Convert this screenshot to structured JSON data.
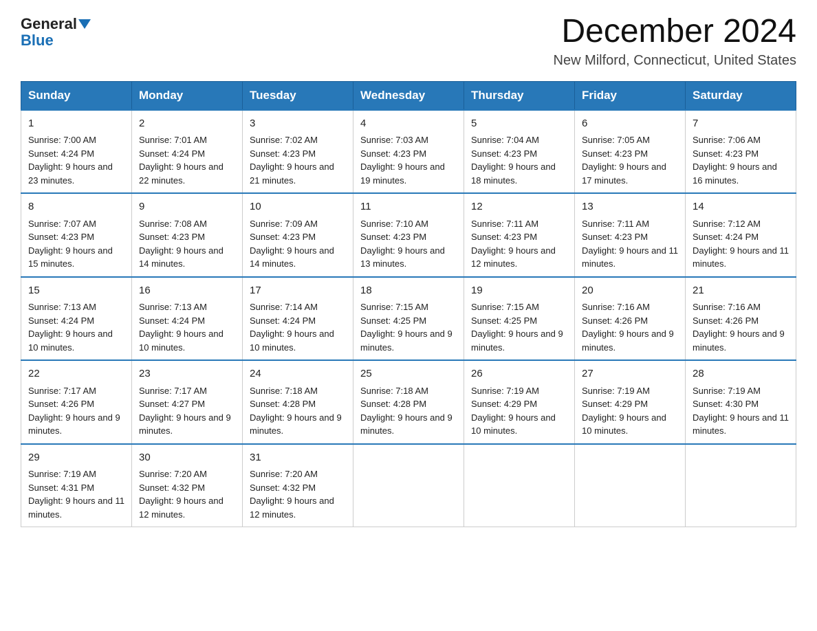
{
  "logo": {
    "word1": "General",
    "word2": "Blue"
  },
  "header": {
    "title": "December 2024",
    "subtitle": "New Milford, Connecticut, United States"
  },
  "weekdays": [
    "Sunday",
    "Monday",
    "Tuesday",
    "Wednesday",
    "Thursday",
    "Friday",
    "Saturday"
  ],
  "weeks": [
    [
      {
        "day": "1",
        "sunrise": "7:00 AM",
        "sunset": "4:24 PM",
        "daylight": "9 hours and 23 minutes."
      },
      {
        "day": "2",
        "sunrise": "7:01 AM",
        "sunset": "4:24 PM",
        "daylight": "9 hours and 22 minutes."
      },
      {
        "day": "3",
        "sunrise": "7:02 AM",
        "sunset": "4:23 PM",
        "daylight": "9 hours and 21 minutes."
      },
      {
        "day": "4",
        "sunrise": "7:03 AM",
        "sunset": "4:23 PM",
        "daylight": "9 hours and 19 minutes."
      },
      {
        "day": "5",
        "sunrise": "7:04 AM",
        "sunset": "4:23 PM",
        "daylight": "9 hours and 18 minutes."
      },
      {
        "day": "6",
        "sunrise": "7:05 AM",
        "sunset": "4:23 PM",
        "daylight": "9 hours and 17 minutes."
      },
      {
        "day": "7",
        "sunrise": "7:06 AM",
        "sunset": "4:23 PM",
        "daylight": "9 hours and 16 minutes."
      }
    ],
    [
      {
        "day": "8",
        "sunrise": "7:07 AM",
        "sunset": "4:23 PM",
        "daylight": "9 hours and 15 minutes."
      },
      {
        "day": "9",
        "sunrise": "7:08 AM",
        "sunset": "4:23 PM",
        "daylight": "9 hours and 14 minutes."
      },
      {
        "day": "10",
        "sunrise": "7:09 AM",
        "sunset": "4:23 PM",
        "daylight": "9 hours and 14 minutes."
      },
      {
        "day": "11",
        "sunrise": "7:10 AM",
        "sunset": "4:23 PM",
        "daylight": "9 hours and 13 minutes."
      },
      {
        "day": "12",
        "sunrise": "7:11 AM",
        "sunset": "4:23 PM",
        "daylight": "9 hours and 12 minutes."
      },
      {
        "day": "13",
        "sunrise": "7:11 AM",
        "sunset": "4:23 PM",
        "daylight": "9 hours and 11 minutes."
      },
      {
        "day": "14",
        "sunrise": "7:12 AM",
        "sunset": "4:24 PM",
        "daylight": "9 hours and 11 minutes."
      }
    ],
    [
      {
        "day": "15",
        "sunrise": "7:13 AM",
        "sunset": "4:24 PM",
        "daylight": "9 hours and 10 minutes."
      },
      {
        "day": "16",
        "sunrise": "7:13 AM",
        "sunset": "4:24 PM",
        "daylight": "9 hours and 10 minutes."
      },
      {
        "day": "17",
        "sunrise": "7:14 AM",
        "sunset": "4:24 PM",
        "daylight": "9 hours and 10 minutes."
      },
      {
        "day": "18",
        "sunrise": "7:15 AM",
        "sunset": "4:25 PM",
        "daylight": "9 hours and 9 minutes."
      },
      {
        "day": "19",
        "sunrise": "7:15 AM",
        "sunset": "4:25 PM",
        "daylight": "9 hours and 9 minutes."
      },
      {
        "day": "20",
        "sunrise": "7:16 AM",
        "sunset": "4:26 PM",
        "daylight": "9 hours and 9 minutes."
      },
      {
        "day": "21",
        "sunrise": "7:16 AM",
        "sunset": "4:26 PM",
        "daylight": "9 hours and 9 minutes."
      }
    ],
    [
      {
        "day": "22",
        "sunrise": "7:17 AM",
        "sunset": "4:26 PM",
        "daylight": "9 hours and 9 minutes."
      },
      {
        "day": "23",
        "sunrise": "7:17 AM",
        "sunset": "4:27 PM",
        "daylight": "9 hours and 9 minutes."
      },
      {
        "day": "24",
        "sunrise": "7:18 AM",
        "sunset": "4:28 PM",
        "daylight": "9 hours and 9 minutes."
      },
      {
        "day": "25",
        "sunrise": "7:18 AM",
        "sunset": "4:28 PM",
        "daylight": "9 hours and 9 minutes."
      },
      {
        "day": "26",
        "sunrise": "7:19 AM",
        "sunset": "4:29 PM",
        "daylight": "9 hours and 10 minutes."
      },
      {
        "day": "27",
        "sunrise": "7:19 AM",
        "sunset": "4:29 PM",
        "daylight": "9 hours and 10 minutes."
      },
      {
        "day": "28",
        "sunrise": "7:19 AM",
        "sunset": "4:30 PM",
        "daylight": "9 hours and 11 minutes."
      }
    ],
    [
      {
        "day": "29",
        "sunrise": "7:19 AM",
        "sunset": "4:31 PM",
        "daylight": "9 hours and 11 minutes."
      },
      {
        "day": "30",
        "sunrise": "7:20 AM",
        "sunset": "4:32 PM",
        "daylight": "9 hours and 12 minutes."
      },
      {
        "day": "31",
        "sunrise": "7:20 AM",
        "sunset": "4:32 PM",
        "daylight": "9 hours and 12 minutes."
      },
      null,
      null,
      null,
      null
    ]
  ]
}
